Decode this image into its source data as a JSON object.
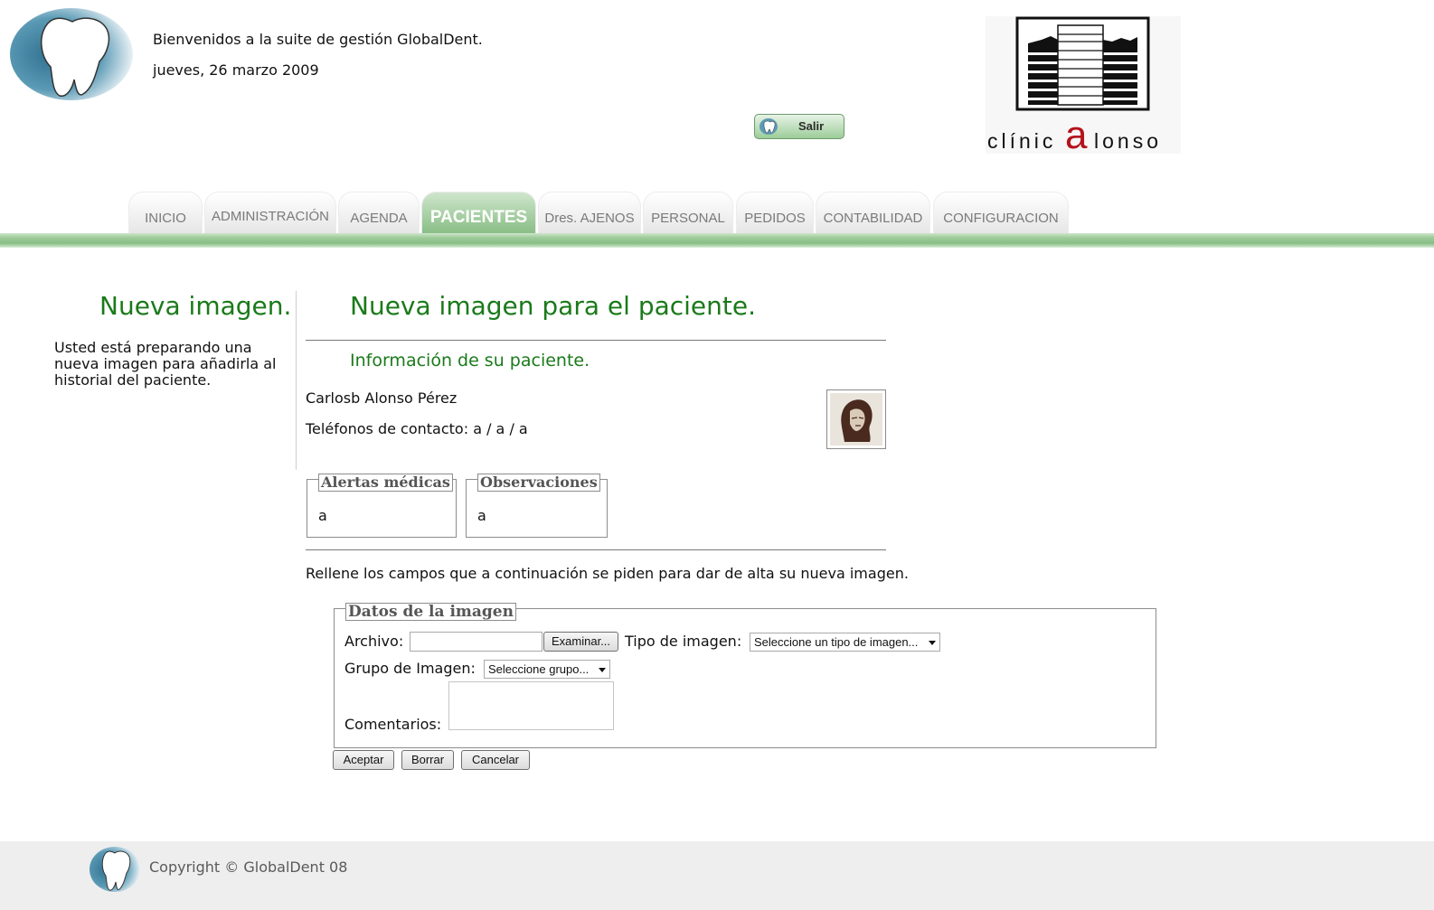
{
  "header": {
    "welcome": "Bienvenidos a la suite de gestión GlobalDent.",
    "date": "jueves, 26 marzo 2009",
    "logout_label": "Salir",
    "clinic_logo_text": "clínicalonso"
  },
  "nav": {
    "tabs": [
      {
        "label": "INICIO",
        "active": false
      },
      {
        "label": "ADMINISTRACIÓN",
        "active": false
      },
      {
        "label": "AGENDA",
        "active": false
      },
      {
        "label": "PACIENTES",
        "active": true
      },
      {
        "label": "Dres. AJENOS",
        "active": false
      },
      {
        "label": "PERSONAL",
        "active": false
      },
      {
        "label": "PEDIDOS",
        "active": false
      },
      {
        "label": "CONTABILIDAD",
        "active": false
      },
      {
        "label": "CONFIGURACION",
        "active": false
      }
    ]
  },
  "sidebar": {
    "title": "Nueva imagen.",
    "text": "Usted está preparando una nueva imagen para añadirla al historial del paciente."
  },
  "main": {
    "title": "Nueva imagen para el paciente.",
    "info_title": "Información de su paciente.",
    "patient_name": "Carlosb Alonso Pérez",
    "patient_phones": "Teléfonos de contacto: a / a / a",
    "alerts_legend": "Alertas médicas",
    "alerts_value": "a",
    "observations_legend": "Observaciones",
    "observations_value": "a",
    "instructions": "Rellene los campos que a continuación se piden para dar de alta su nueva imagen."
  },
  "form": {
    "legend": "Datos de la imagen",
    "file_label": "Archivo:",
    "browse_label": "Examinar...",
    "type_label": "Tipo de imagen:",
    "type_selected": "Seleccione un tipo de imagen...",
    "group_label": "Grupo de Imagen:",
    "group_selected": "Seleccione grupo...",
    "comments_label": "Comentarios:",
    "accept_label": "Aceptar",
    "clear_label": "Borrar",
    "cancel_label": "Cancelar"
  },
  "footer": {
    "copyright": "Copyright © GlobalDent 08"
  },
  "colors": {
    "green_title": "#1a7a1a",
    "nav_bar": "#88bd85",
    "active_tab": "#89be86"
  }
}
